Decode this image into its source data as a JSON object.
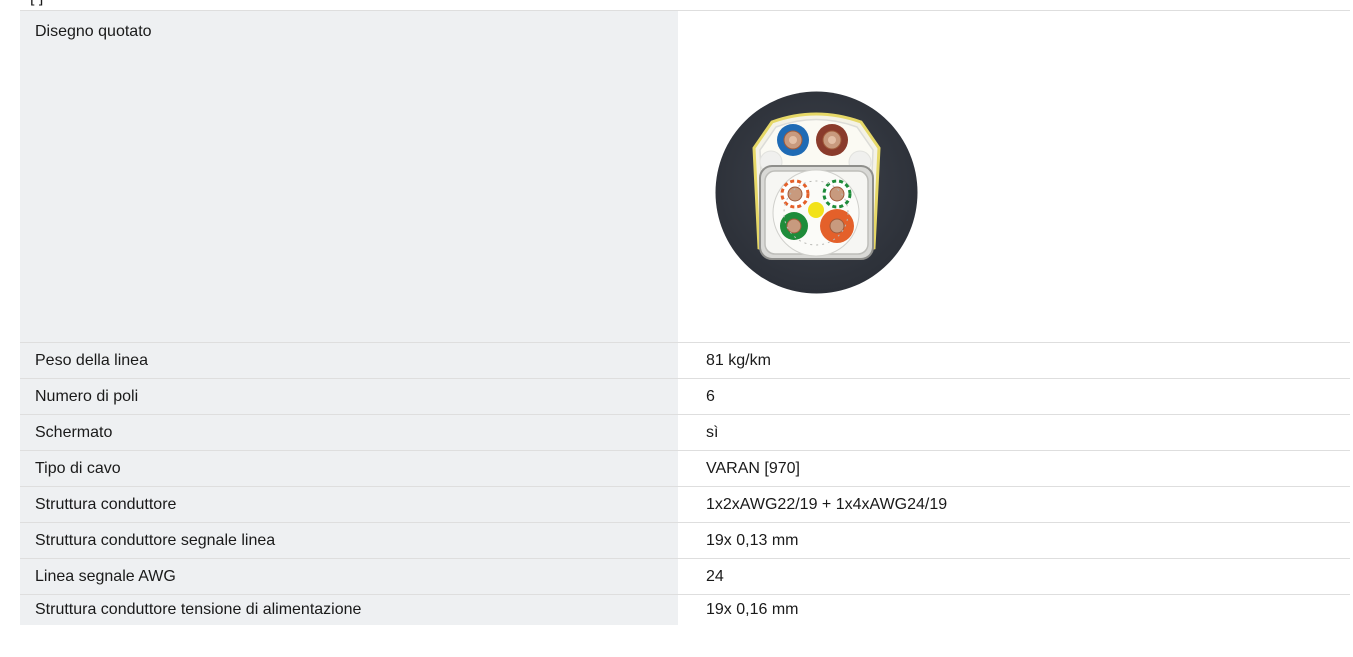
{
  "header_clip": "[   ]",
  "drawing": {
    "label": "Disegno quotato",
    "colors": {
      "jacket": "#343841",
      "blue": "#1f6bb5",
      "brown": "#8a3b2c",
      "green": "#1e8c3a",
      "orange": "#e4602a",
      "yellow": "#f2e21a"
    }
  },
  "rows": [
    {
      "label": "Peso della linea",
      "value": "81 kg/km"
    },
    {
      "label": "Numero di poli",
      "value": "6"
    },
    {
      "label": "Schermato",
      "value": "sì"
    },
    {
      "label": "Tipo di cavo",
      "value": "VARAN [970]"
    },
    {
      "label": "Struttura conduttore",
      "value": "1x2xAWG22/19 + 1x4xAWG24/19"
    },
    {
      "label": "Struttura conduttore segnale linea",
      "value": "19x 0,13 mm"
    },
    {
      "label": "Linea segnale AWG",
      "value": "24"
    },
    {
      "label": "Struttura conduttore tensione di alimentazione",
      "value": "19x 0,16 mm"
    }
  ]
}
